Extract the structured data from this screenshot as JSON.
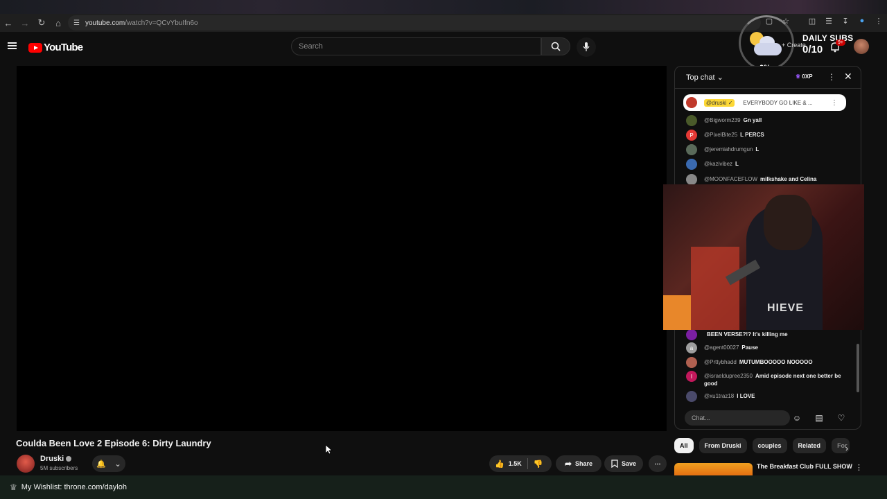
{
  "browser": {
    "url_host": "youtube.com",
    "url_path": "/watch?v=QCvYbuIfn6o"
  },
  "header": {
    "logo_text": "YouTube",
    "search_placeholder": "Search",
    "create_label": "Create",
    "notification_badge": "9+"
  },
  "overlay": {
    "percent": "0%",
    "daily_subs_label": "DAILY SUBS",
    "daily_subs_count": "0/10"
  },
  "video": {
    "title": "Coulda Been Love 2 Episode 6: Dirty Laundry",
    "channel_name": "Druski",
    "channel_subs": "5M subscribers",
    "like_count": "1.5K",
    "share_label": "Share",
    "save_label": "Save"
  },
  "chat": {
    "header_label": "Top chat",
    "xp_label": "0XP",
    "pinned": {
      "user": "@druski",
      "message": "EVERYBODY GO LIKE & ..."
    },
    "messages": [
      {
        "user": "@Bigworm239",
        "text": "Gn yall",
        "avatar_color": "#4a5a2a",
        "initial": ""
      },
      {
        "user": "@PixelBite25",
        "text": "L PERCS",
        "avatar_color": "#e53935",
        "initial": "P"
      },
      {
        "user": "@jeremiahdrumgun",
        "text": "L",
        "avatar_color": "#5a6a5a",
        "initial": ""
      },
      {
        "user": "@kazivibez",
        "text": "L",
        "avatar_color": "#3a6ab0",
        "initial": ""
      },
      {
        "user": "@MOONFACEFLOW",
        "text": "milkshake and Celina",
        "avatar_color": "#888",
        "initial": ""
      }
    ],
    "lower_messages": [
      {
        "user": "",
        "text": "BEEN VERSE?!? It's killing me",
        "avatar_color": "#7b1fa2",
        "initial": ""
      },
      {
        "user": "@agent00027",
        "text": "Pause",
        "avatar_color": "#9e9e9e",
        "initial": "a"
      },
      {
        "user": "@Prttybhadd",
        "text": "MUTUMBOOOOO NOOOOO",
        "avatar_color": "#b06050",
        "initial": ""
      },
      {
        "user": "@israeldupree2350",
        "text": "Amid episode next one better be good",
        "avatar_color": "#c2185b",
        "initial": "I"
      },
      {
        "user": "@xu1traz18",
        "text": "I LOVE",
        "avatar_color": "#4a4a6a",
        "initial": ""
      }
    ],
    "input_placeholder": "Chat...",
    "webcam_shirt_text": "HIEVE"
  },
  "chips": [
    "All",
    "From Druski",
    "couples",
    "Related",
    "For"
  ],
  "recommendation": {
    "title": "The Breakfast Club FULL SHOW"
  },
  "bottom_banner": "My Wishlist: throne.com/dayloh"
}
